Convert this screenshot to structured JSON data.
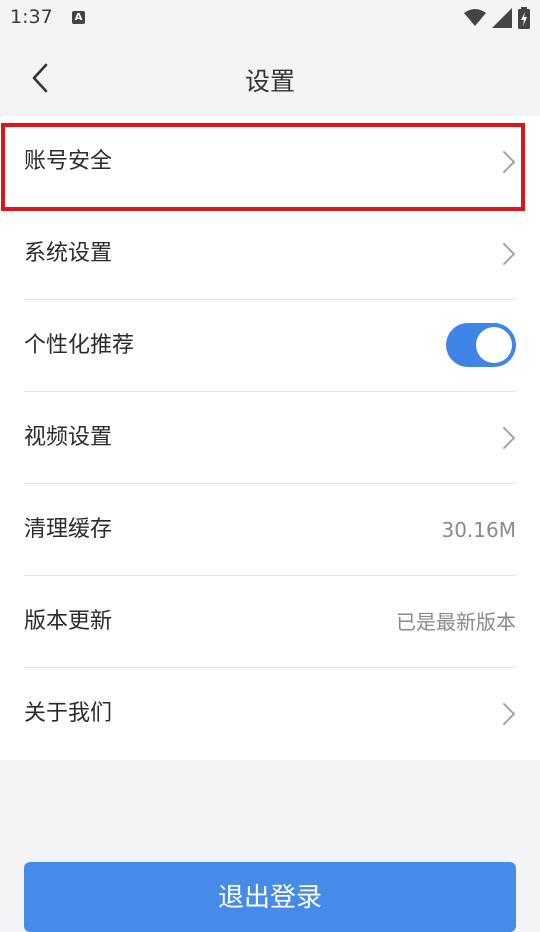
{
  "status_bar": {
    "time": "1:37",
    "notification_icon": "a-badge-icon",
    "icons": [
      "wifi-icon",
      "signal-icon",
      "battery-charging-icon"
    ]
  },
  "nav": {
    "title": "设置",
    "back_icon": "chevron-left-icon"
  },
  "settings": {
    "items": [
      {
        "label": "账号安全",
        "accessory": "chevron",
        "highlighted": true
      },
      {
        "label": "系统设置",
        "accessory": "chevron"
      },
      {
        "label": "个性化推荐",
        "accessory": "toggle",
        "toggle_on": true
      },
      {
        "label": "视频设置",
        "accessory": "chevron"
      },
      {
        "label": "清理缓存",
        "accessory": "value",
        "value": "30.16M"
      },
      {
        "label": "版本更新",
        "accessory": "value",
        "value": "已是最新版本"
      },
      {
        "label": "关于我们",
        "accessory": "chevron"
      }
    ]
  },
  "logout": {
    "label": "退出登录"
  },
  "colors": {
    "accent": "#468be8",
    "toggle_on": "#3f85e6",
    "highlight": "#e0121a",
    "background": "#f4f4f6"
  }
}
